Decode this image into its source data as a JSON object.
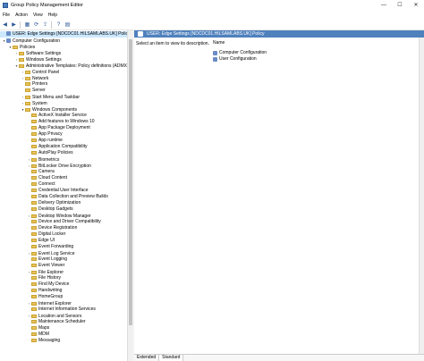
{
  "window": {
    "title": "Group Policy Management Editor",
    "minimize": "—",
    "maximize": "☐",
    "close": "✕"
  },
  "menu": [
    "File",
    "Action",
    "View",
    "Help"
  ],
  "tree": [
    {
      "label": "USER: Edge Settings [NDCDC01.HILSAMLABS.UK] Policy",
      "indent": 0,
      "twisty": "",
      "icon": "policy",
      "selected": true
    },
    {
      "label": "Computer Configuration",
      "indent": 0,
      "twisty": "▾",
      "icon": "node"
    },
    {
      "label": "Policies",
      "indent": 1,
      "twisty": "▾",
      "icon": "folder"
    },
    {
      "label": "Software Settings",
      "indent": 2,
      "twisty": "›",
      "icon": "folder"
    },
    {
      "label": "Windows Settings",
      "indent": 2,
      "twisty": "›",
      "icon": "folder"
    },
    {
      "label": "Administrative Templates: Policy definitions (ADMX",
      "indent": 2,
      "twisty": "▾",
      "icon": "folder"
    },
    {
      "label": "Control Panel",
      "indent": 3,
      "twisty": "›",
      "icon": "folder"
    },
    {
      "label": "Network",
      "indent": 3,
      "twisty": "›",
      "icon": "folder"
    },
    {
      "label": "Printers",
      "indent": 3,
      "twisty": "",
      "icon": "folder"
    },
    {
      "label": "Server",
      "indent": 3,
      "twisty": "",
      "icon": "folder"
    },
    {
      "label": "Start Menu and Taskbar",
      "indent": 3,
      "twisty": "›",
      "icon": "folder"
    },
    {
      "label": "System",
      "indent": 3,
      "twisty": "›",
      "icon": "folder"
    },
    {
      "label": "Windows Components",
      "indent": 3,
      "twisty": "▾",
      "icon": "folder"
    },
    {
      "label": "ActiveX Installer Service",
      "indent": 4,
      "twisty": "",
      "icon": "folder"
    },
    {
      "label": "Add features to Windows 10",
      "indent": 4,
      "twisty": "",
      "icon": "folder"
    },
    {
      "label": "App Package Deployment",
      "indent": 4,
      "twisty": "",
      "icon": "folder"
    },
    {
      "label": "App Privacy",
      "indent": 4,
      "twisty": "",
      "icon": "folder"
    },
    {
      "label": "App runtime",
      "indent": 4,
      "twisty": "",
      "icon": "folder"
    },
    {
      "label": "Application Compatibility",
      "indent": 4,
      "twisty": "",
      "icon": "folder"
    },
    {
      "label": "AutoPlay Policies",
      "indent": 4,
      "twisty": "",
      "icon": "folder"
    },
    {
      "label": "Biometrics",
      "indent": 4,
      "twisty": "›",
      "icon": "folder"
    },
    {
      "label": "BitLocker Drive Encryption",
      "indent": 4,
      "twisty": "›",
      "icon": "folder"
    },
    {
      "label": "Camera",
      "indent": 4,
      "twisty": "",
      "icon": "folder"
    },
    {
      "label": "Cloud Content",
      "indent": 4,
      "twisty": "",
      "icon": "folder"
    },
    {
      "label": "Connect",
      "indent": 4,
      "twisty": "",
      "icon": "folder"
    },
    {
      "label": "Credential User Interface",
      "indent": 4,
      "twisty": "",
      "icon": "folder"
    },
    {
      "label": "Data Collection and Preview Builds",
      "indent": 4,
      "twisty": "",
      "icon": "folder"
    },
    {
      "label": "Delivery Optimization",
      "indent": 4,
      "twisty": "",
      "icon": "folder"
    },
    {
      "label": "Desktop Gadgets",
      "indent": 4,
      "twisty": "",
      "icon": "folder"
    },
    {
      "label": "Desktop Window Manager",
      "indent": 4,
      "twisty": "›",
      "icon": "folder"
    },
    {
      "label": "Device and Driver Compatibility",
      "indent": 4,
      "twisty": "",
      "icon": "folder"
    },
    {
      "label": "Device Registration",
      "indent": 4,
      "twisty": "",
      "icon": "folder"
    },
    {
      "label": "Digital Locker",
      "indent": 4,
      "twisty": "",
      "icon": "folder"
    },
    {
      "label": "Edge UI",
      "indent": 4,
      "twisty": "",
      "icon": "folder"
    },
    {
      "label": "Event Forwarding",
      "indent": 4,
      "twisty": "",
      "icon": "folder"
    },
    {
      "label": "Event Log Service",
      "indent": 4,
      "twisty": "›",
      "icon": "folder"
    },
    {
      "label": "Event Logging",
      "indent": 4,
      "twisty": "",
      "icon": "folder"
    },
    {
      "label": "Event Viewer",
      "indent": 4,
      "twisty": "",
      "icon": "folder"
    },
    {
      "label": "File Explorer",
      "indent": 4,
      "twisty": "›",
      "icon": "folder"
    },
    {
      "label": "File History",
      "indent": 4,
      "twisty": "",
      "icon": "folder"
    },
    {
      "label": "Find My Device",
      "indent": 4,
      "twisty": "",
      "icon": "folder"
    },
    {
      "label": "Handwriting",
      "indent": 4,
      "twisty": "",
      "icon": "folder"
    },
    {
      "label": "HomeGroup",
      "indent": 4,
      "twisty": "",
      "icon": "folder"
    },
    {
      "label": "Internet Explorer",
      "indent": 4,
      "twisty": "›",
      "icon": "folder"
    },
    {
      "label": "Internet Information Services",
      "indent": 4,
      "twisty": "",
      "icon": "folder"
    },
    {
      "label": "Location and Sensors",
      "indent": 4,
      "twisty": "›",
      "icon": "folder"
    },
    {
      "label": "Maintenance Scheduler",
      "indent": 4,
      "twisty": "",
      "icon": "folder"
    },
    {
      "label": "Maps",
      "indent": 4,
      "twisty": "",
      "icon": "folder"
    },
    {
      "label": "MDM",
      "indent": 4,
      "twisty": "",
      "icon": "folder"
    },
    {
      "label": "Messaging",
      "indent": 4,
      "twisty": "",
      "icon": "folder"
    }
  ],
  "right": {
    "header": "USER: Edge Settings [NDCDC01.HILSAMLABS.UK] Policy",
    "description": "Select an item to view its description.",
    "column_name": "Name",
    "items": [
      "Computer Configuration",
      "User Configuration"
    ],
    "tabs": [
      "Extended",
      "Standard"
    ]
  },
  "colors": {
    "header_bg": "#4f81bd",
    "selection": "#cce8ff"
  }
}
